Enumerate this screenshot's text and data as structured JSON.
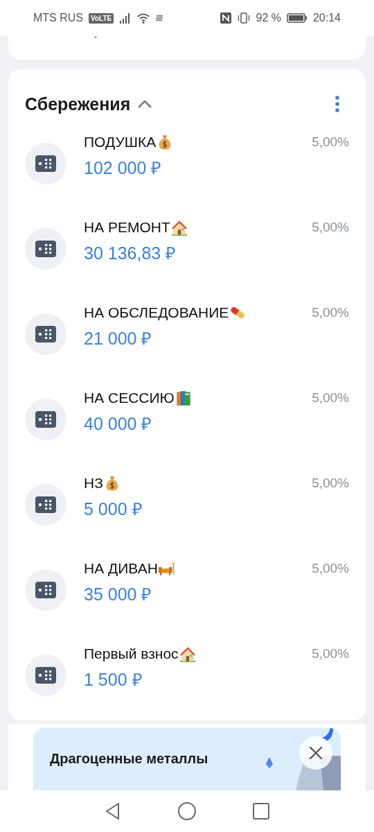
{
  "status_bar": {
    "carrier": "MTS RUS",
    "volte": "VoLTE",
    "battery": "92 %",
    "time": "20:14"
  },
  "top_card": {
    "fragment": "-"
  },
  "savings": {
    "title": "Сбережения",
    "expanded": true,
    "accounts": [
      {
        "name": "ПОДУШКА",
        "kind": "money-bag",
        "amount": "102 000 ₽",
        "rate": "5,00%"
      },
      {
        "name": "НА РЕМОНТ",
        "kind": "house",
        "amount": "30 136,83 ₽",
        "rate": "5,00%"
      },
      {
        "name": "НА ОБСЛЕДОВАНИЕ",
        "kind": "pill",
        "amount": "21 000 ₽",
        "rate": "5,00%"
      },
      {
        "name": "НА СЕССИЮ",
        "kind": "books",
        "amount": "40 000 ₽",
        "rate": "5,00%"
      },
      {
        "name": "НЗ",
        "kind": "money-bag",
        "amount": "5 000 ₽",
        "rate": "5,00%"
      },
      {
        "name": "НА ДИВАН",
        "kind": "sofa",
        "amount": "35 000 ₽",
        "rate": "5,00%"
      },
      {
        "name": "Первый взнос",
        "kind": "house",
        "amount": "1 500 ₽",
        "rate": "5,00%"
      }
    ]
  },
  "promo": {
    "title": "Драгоценные металлы"
  }
}
